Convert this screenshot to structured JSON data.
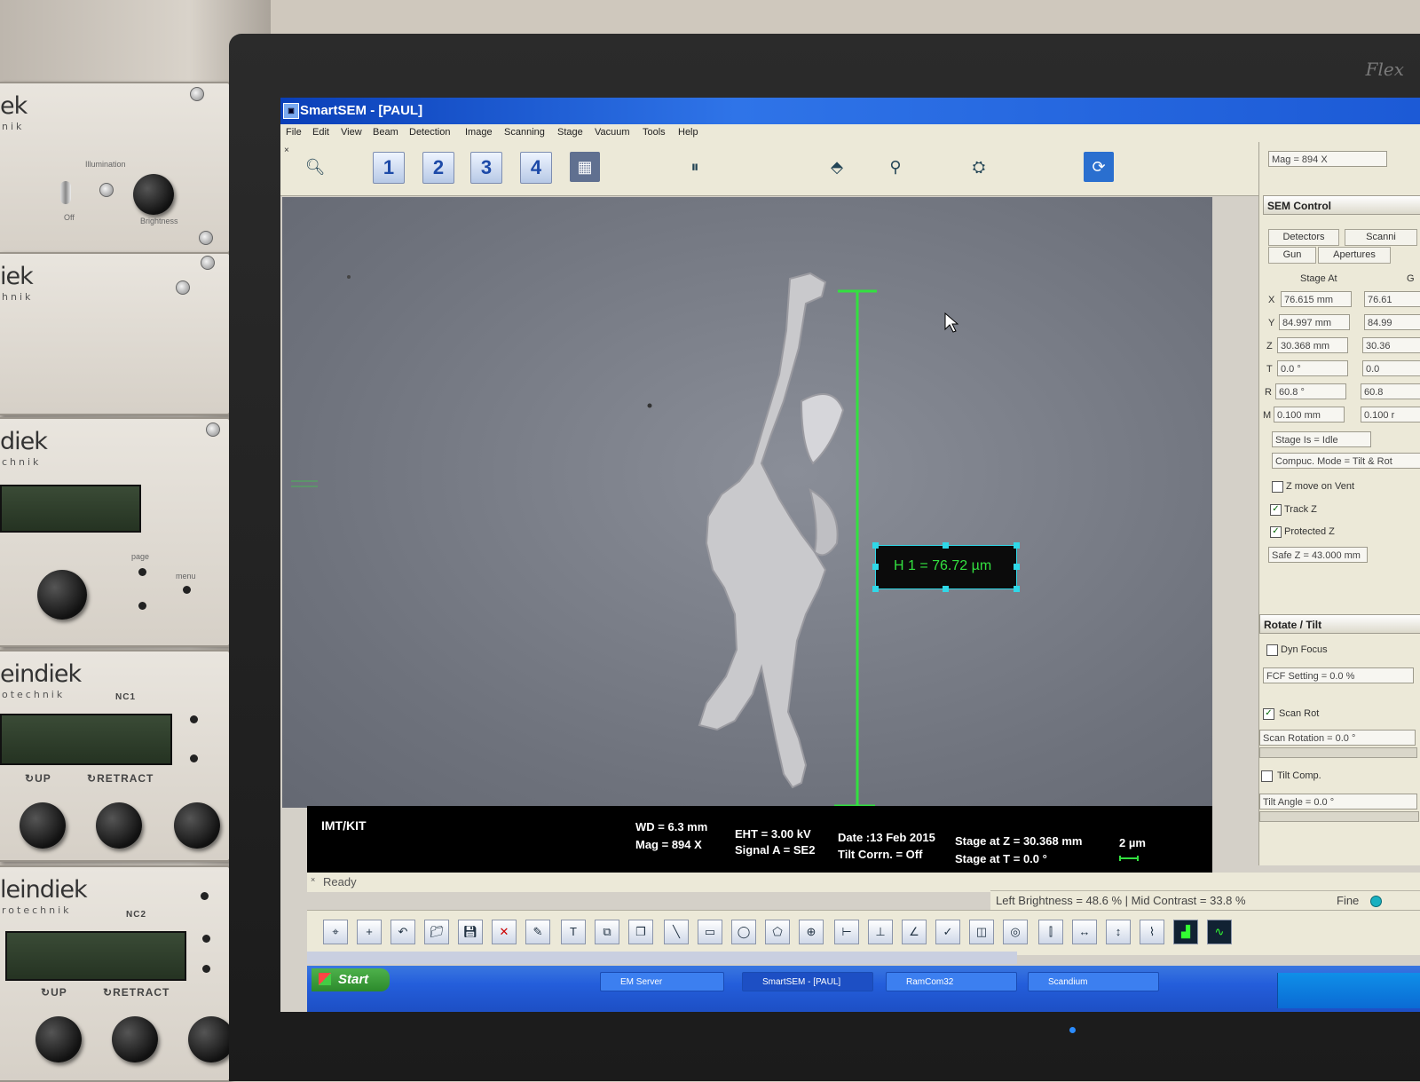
{
  "rack": {
    "panels": [
      {
        "brand": "ek",
        "sub": "nik",
        "labels": [
          "Illumination",
          "Off",
          "Brightness"
        ]
      },
      {
        "brand": "iek",
        "sub": "hnik",
        "labels": []
      },
      {
        "brand": "diek",
        "sub": "chnik",
        "labels": [
          "page",
          "menu"
        ]
      },
      {
        "brand": "eindiek",
        "sub": "otechnik",
        "model": "NC1",
        "up": "UP",
        "retract": "RETRACT"
      },
      {
        "brand": "leindiek",
        "sub": "rotechnik",
        "model": "NC2",
        "up": "UP",
        "retract": "RETRACT"
      }
    ]
  },
  "monitor": {
    "brand": "Flex"
  },
  "window": {
    "title": "SmartSEM - [PAUL]",
    "menu": [
      "File",
      "Edit",
      "View",
      "Beam",
      "Detection",
      "Image",
      "Scanning",
      "Stage",
      "Vacuum",
      "Tools",
      "Help"
    ],
    "toolbar_numbers": [
      "1",
      "2",
      "3",
      "4"
    ]
  },
  "measurement": {
    "label": "H 1 = 76.72 µm"
  },
  "databar": {
    "org": "IMT/KIT",
    "wd": "WD = 6.3 mm",
    "mag": "Mag = 894 X",
    "eht": "EHT = 3.00 kV",
    "signal": "Signal A = SE2",
    "date": "Date :13 Feb 2015",
    "tilt_corr": "Tilt Corrn. = Off",
    "stage_z": "Stage at Z = 30.368 mm",
    "stage_t": "Stage at T = 0.0 °",
    "scalebar": "2 µm"
  },
  "status": {
    "ready": "Ready",
    "brightness": "Left Brightness = 48.6 % | Mid Contrast = 33.8 %",
    "fine": "Fine"
  },
  "taskbar": {
    "start": "Start",
    "items": [
      "EM Server",
      "SmartSEM - [PAUL]",
      "RamCom32",
      "Scandium"
    ]
  },
  "panel": {
    "mag_field": "Mag = 894 X",
    "sem_control": "SEM Control",
    "tabs_row1": [
      "Detectors",
      "Scanni"
    ],
    "tabs_row2": [
      "Gun",
      "Apertures"
    ],
    "stage_at": "Stage At",
    "stage_col2": "G",
    "axes": [
      "X",
      "Y",
      "Z",
      "T",
      "R",
      "M"
    ],
    "values": [
      "76.615 mm",
      "84.997 mm",
      "30.368 mm",
      "0.0 °",
      "60.8 °",
      "0.100 mm"
    ],
    "values2": [
      "76.61",
      "84.99",
      "30.36",
      "0.0",
      "60.8",
      "0.100 r"
    ],
    "stage_idle": "Stage Is = Idle",
    "compuc_mode": "Compuc. Mode = Tilt & Rot",
    "z_move": "Z move on Vent",
    "track_z": "Track Z",
    "protected_z": "Protected Z",
    "safe_z": "Safe Z = 43.000 mm",
    "rotate_tilt": "Rotate / Tilt",
    "dyn_focus": "Dyn Focus",
    "fcf_setting": "FCF Setting = 0.0 %",
    "scan_rot": "Scan Rot",
    "scan_rotation": "Scan Rotation = 0.0 °",
    "tilt_comp": "Tilt Comp.",
    "tilt_angle": "Tilt Angle = 0.0 °"
  },
  "colors": {
    "measure_green": "#33e040",
    "titlebar_blue": "#1c5ad6",
    "handle_cyan": "#2fd8e8"
  }
}
